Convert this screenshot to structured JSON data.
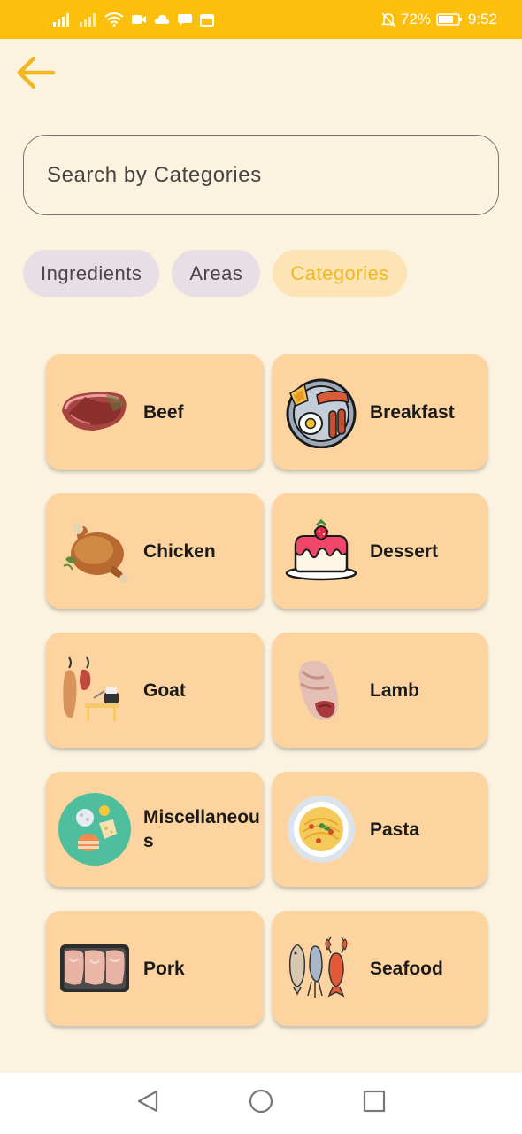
{
  "status_bar": {
    "battery": "72%",
    "time": "9:52",
    "icons": [
      "signal-icon",
      "signal-icon",
      "wifi-icon",
      "video-icon",
      "cloud-icon",
      "message-icon",
      "calendar-icon",
      "mute-bell-icon",
      "battery-icon"
    ]
  },
  "header": {
    "back_icon": "arrow-left-icon"
  },
  "search": {
    "placeholder": "Search by Categories",
    "value": ""
  },
  "tabs": [
    {
      "label": "Ingredients",
      "active": false
    },
    {
      "label": "Areas",
      "active": false
    },
    {
      "label": "Categories",
      "active": true
    }
  ],
  "categories": [
    {
      "label": "Beef",
      "icon": "beef-icon"
    },
    {
      "label": "Breakfast",
      "icon": "breakfast-icon"
    },
    {
      "label": "Chicken",
      "icon": "chicken-icon"
    },
    {
      "label": "Dessert",
      "icon": "dessert-icon"
    },
    {
      "label": "Goat",
      "icon": "goat-icon"
    },
    {
      "label": "Lamb",
      "icon": "lamb-icon"
    },
    {
      "label": "Miscellaneous",
      "icon": "miscellaneous-icon"
    },
    {
      "label": "Pasta",
      "icon": "pasta-icon"
    },
    {
      "label": "Pork",
      "icon": "pork-icon"
    },
    {
      "label": "Seafood",
      "icon": "seafood-icon"
    }
  ],
  "nav_bar": {
    "back": "triangle-back-icon",
    "home": "circle-home-icon",
    "recents": "square-recents-icon"
  },
  "colors": {
    "accent": "#FBBF0C",
    "background": "#FBF2DF",
    "card": "#FDD49F",
    "chip": "#E7DEE6",
    "chip_active": "#FCE4B4"
  }
}
